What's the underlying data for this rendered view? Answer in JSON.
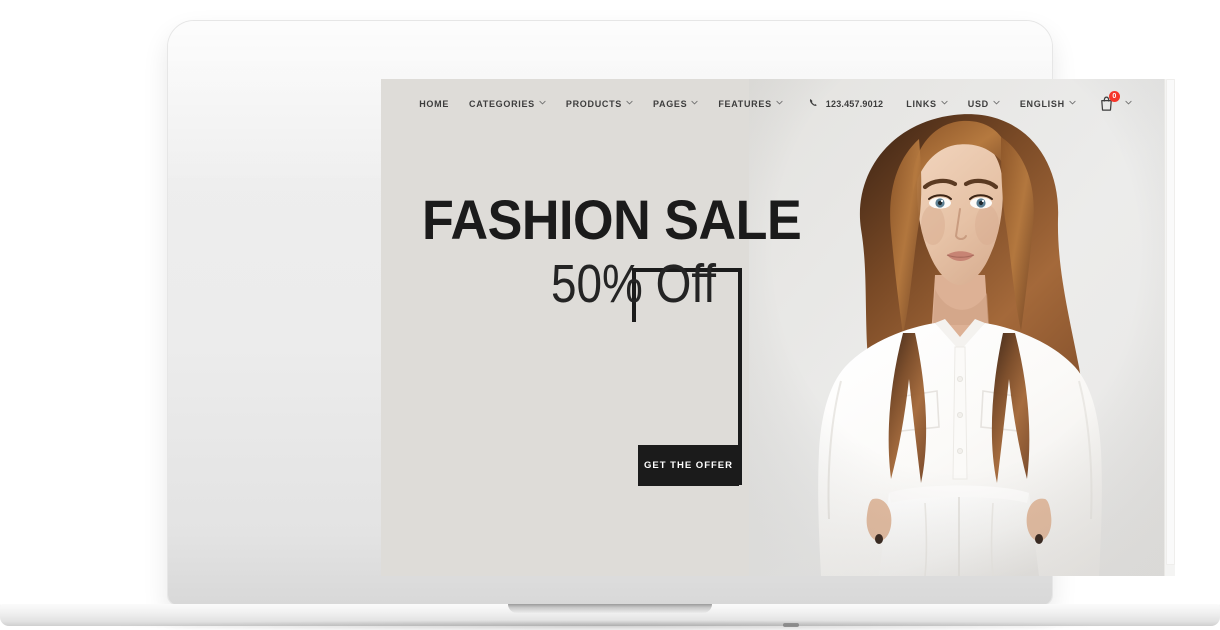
{
  "device": {
    "type": "laptop-mockup",
    "screen_background": "#dedcd8"
  },
  "site": {
    "nav": {
      "items": [
        {
          "label": "HOME",
          "has_dropdown": false
        },
        {
          "label": "CATEGORIES",
          "has_dropdown": true
        },
        {
          "label": "PRODUCTS",
          "has_dropdown": true
        },
        {
          "label": "PAGES",
          "has_dropdown": true
        },
        {
          "label": "FEATURES",
          "has_dropdown": true
        }
      ],
      "phone": "123.457.9012",
      "phone_icon": "phone-icon",
      "utility": [
        {
          "label": "LINKS",
          "has_dropdown": true
        },
        {
          "label": "USD",
          "has_dropdown": true
        },
        {
          "label": "ENGLISH",
          "has_dropdown": true
        }
      ],
      "cart": {
        "icon": "shopping-bag-icon",
        "count": "0",
        "badge_color": "#f5352a",
        "has_dropdown": true
      },
      "text_color": "#3d3d3d"
    },
    "hero": {
      "headline": "FASHION SALE",
      "subhead": "50% Off",
      "cta_label": "GET THE OFFER",
      "cta_background": "#1b1b1b",
      "cta_text_color": "#ffffff",
      "frame_color": "#1b1b1b",
      "headline_color": "#1b1b1b",
      "subhead_color": "#242424",
      "background": "#dedcd8",
      "image_alt": "fashion model in white blouse and white trousers"
    },
    "scrollbar": {
      "name": "vertical-scrollbar",
      "track_color": "#f4f4f3",
      "thumb_color": "#fafafa"
    }
  }
}
